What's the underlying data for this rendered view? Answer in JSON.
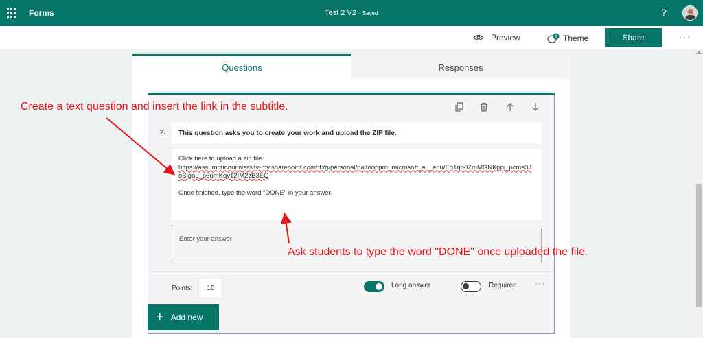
{
  "header": {
    "app_name": "Forms",
    "doc_title": "Test 2 V2",
    "doc_status": "- Saved",
    "help": "?"
  },
  "toolbar": {
    "preview_label": "Preview",
    "theme_label": "Theme",
    "share_label": "Share",
    "more": "···"
  },
  "tabs": [
    {
      "label": "Questions",
      "active": true
    },
    {
      "label": "Responses",
      "active": false
    }
  ],
  "question": {
    "number": "2.",
    "title": "This question asks you to create your work and upload the ZIP file.",
    "subtitle_line1": "Click here to upload a zip file.",
    "subtitle_link": "https://assumptionuniversity-my.sharepoint.com/:f:/g/personal/paitoonprn_microsoft_au_edu/Eq1qb0ZmMGNKppj_pcms3JoBlgoL_p6umKqy12IM2zB3EQ",
    "subtitle_line2": "Once finished, type the word \"DONE\" in your answer.",
    "answer_placeholder": "Enter your answer",
    "points_label": "Points:",
    "points_value": "10",
    "long_answer_label": "Long answer",
    "long_answer_on": true,
    "required_label": "Required",
    "required_on": false,
    "more_options": "···"
  },
  "add_new_label": "Add new",
  "annotations": {
    "top": "Create a text question and insert the link in the subtitle.",
    "bottom": "Ask students to type the word \"DONE\" once uploaded the file."
  },
  "colors": {
    "brand": "#077568",
    "annotation": "#e8141a"
  }
}
